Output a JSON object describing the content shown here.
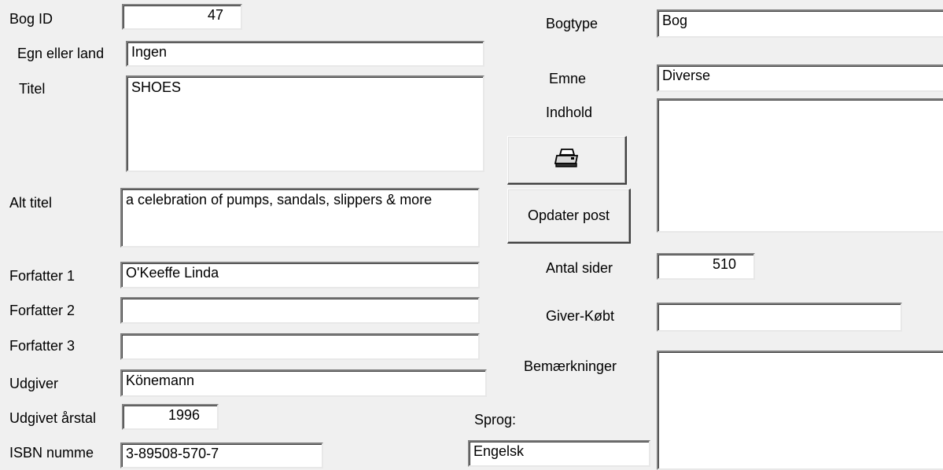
{
  "labels": {
    "bog_id": "Bog ID",
    "egn": "Egn eller land",
    "titel": "Titel",
    "alt_titel": "Alt titel",
    "forfatter1": "Forfatter 1",
    "forfatter2": "Forfatter 2",
    "forfatter3": "Forfatter 3",
    "udgiver": "Udgiver",
    "udgivet": "Udgivet årstal",
    "isbn": "ISBN numme",
    "bogtype": "Bogtype",
    "emne": "Emne",
    "indhold": "Indhold",
    "antal_sider": "Antal sider",
    "giver": "Giver-Købt",
    "bemaerkninger": "Bemærkninger",
    "sprog": "Sprog:"
  },
  "values": {
    "bog_id": "47",
    "egn": "Ingen",
    "titel": "SHOES",
    "alt_titel": "a celebration of pumps, sandals, slippers & more",
    "forfatter1": "O'Keeffe Linda",
    "forfatter2": "",
    "forfatter3": "",
    "udgiver": "Könemann",
    "udgivet": "1996",
    "isbn": "3-89508-570-7",
    "bogtype": "Bog",
    "emne": "Diverse",
    "indhold": "",
    "antal_sider": "510",
    "giver": "",
    "bemaerkninger": "",
    "sprog": "Engelsk"
  },
  "buttons": {
    "print_icon": "printer-icon",
    "opdater": "Opdater post"
  }
}
